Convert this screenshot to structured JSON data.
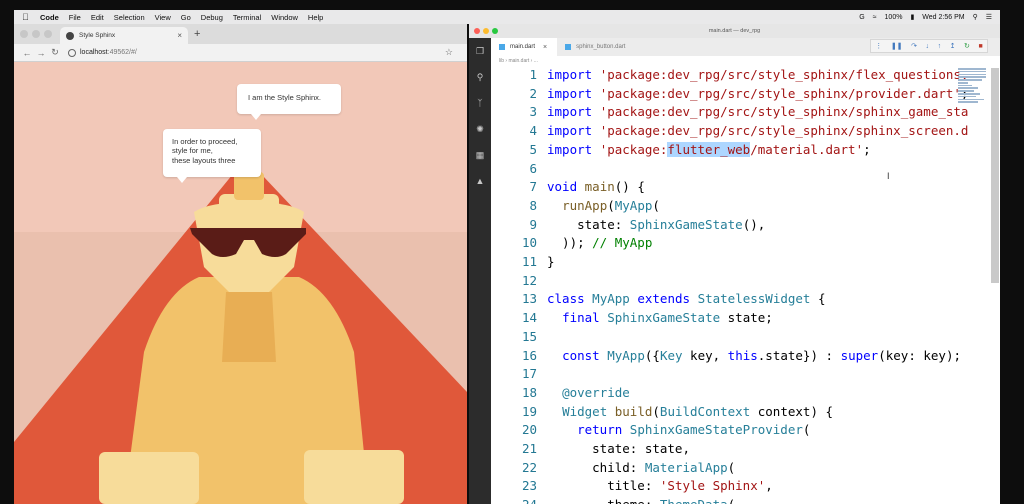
{
  "menubar": {
    "app": "Code",
    "items": [
      "File",
      "Edit",
      "Selection",
      "View",
      "Go",
      "Debug",
      "Terminal",
      "Window",
      "Help"
    ],
    "status": {
      "battery": "100%",
      "clock": "Wed 2:56 PM"
    }
  },
  "browser": {
    "tab_title": "Style Sphinx",
    "url_host": "localhost",
    "url_path": ":49562/#/",
    "bubbles": {
      "sphinx": "I am the Style Sphinx.",
      "riddle": [
        "In order to proceed,",
        "style for me,",
        "these layouts three"
      ]
    },
    "colors": {
      "sky_top": "#f2c8b8",
      "sky_bottom": "#eac0ae",
      "pyramid": "#e0583a",
      "sphinx_body": "#f2c26a",
      "sphinx_light": "#f7dc9a",
      "sphinx_shadow": "#e8ae54",
      "glasses": "#5a1c17"
    }
  },
  "editor": {
    "window_title": "main.dart — dev_rpg",
    "tabs": [
      {
        "label": "main.dart",
        "active": true
      },
      {
        "label": "sphinx_button.dart",
        "active": false
      }
    ],
    "breadcrumb": "lib › main.dart › ...",
    "lines": [
      {
        "n": "1",
        "html": "<span class='kw'>import</span> <span class='str'>'package:dev_rpg/src/style_sphinx/flex_questions.</span>"
      },
      {
        "n": "2",
        "html": "<span class='kw'>import</span> <span class='str'>'package:dev_rpg/src/style_sphinx/provider.dart'</span>;"
      },
      {
        "n": "3",
        "html": "<span class='kw'>import</span> <span class='str'>'package:dev_rpg/src/style_sphinx/sphinx_game_sta</span>"
      },
      {
        "n": "4",
        "html": "<span class='kw'>import</span> <span class='str'>'package:dev_rpg/src/style_sphinx/sphinx_screen.d</span>"
      },
      {
        "n": "5",
        "html": "<span class='kw'>import</span> <span class='str'>'package:<span class='hl'>flutter_web</span>/material.dart'</span>;"
      },
      {
        "n": "6",
        "html": ""
      },
      {
        "n": "7",
        "html": "<span class='kw'>void</span> <span class='fn'>main</span>() {"
      },
      {
        "n": "8",
        "html": "  <span class='fn'>runApp</span>(<span class='ty'>MyApp</span>("
      },
      {
        "n": "9",
        "html": "    state: <span class='ty'>SphinxGameState</span>(),"
      },
      {
        "n": "10",
        "html": "  )); <span class='cm'>// MyApp</span>"
      },
      {
        "n": "11",
        "html": "}"
      },
      {
        "n": "12",
        "html": ""
      },
      {
        "n": "13",
        "html": "<span class='kw'>class</span> <span class='ty'>MyApp</span> <span class='kw'>extends</span> <span class='ty'>StatelessWidget</span> {"
      },
      {
        "n": "14",
        "html": "  <span class='kw'>final</span> <span class='ty'>SphinxGameState</span> state;"
      },
      {
        "n": "15",
        "html": ""
      },
      {
        "n": "16",
        "html": "  <span class='kw'>const</span> <span class='ty'>MyApp</span>({<span class='ty'>Key</span> key, <span class='kw'>this</span>.state}) : <span class='kw'>super</span>(key: key);"
      },
      {
        "n": "17",
        "html": ""
      },
      {
        "n": "18",
        "html": "  <span class='ty'>@override</span>"
      },
      {
        "n": "19",
        "html": "  <span class='ty'>Widget</span> <span class='fn'>build</span>(<span class='ty'>BuildContext</span> context) {"
      },
      {
        "n": "20",
        "html": "    <span class='kw'>return</span> <span class='ty'>SphinxGameStateProvider</span>("
      },
      {
        "n": "21",
        "html": "      state: state,"
      },
      {
        "n": "22",
        "html": "      child: <span class='ty'>MaterialApp</span>("
      },
      {
        "n": "23",
        "html": "        title: <span class='str'>'Style Sphinx'</span>,"
      },
      {
        "n": "24",
        "html": "        theme: <span class='ty'>ThemeData</span>("
      }
    ]
  }
}
